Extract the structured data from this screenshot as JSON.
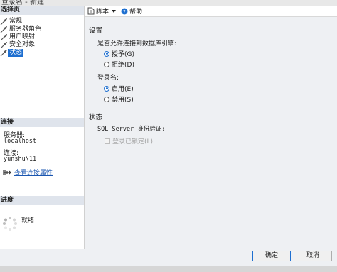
{
  "window": {
    "title": "登录名 - 新建"
  },
  "left_panel": {
    "select_page_header": "选择页",
    "nav_items": [
      {
        "label": "常规"
      },
      {
        "label": "服务器角色"
      },
      {
        "label": "用户映射"
      },
      {
        "label": "安全对象"
      },
      {
        "label": "状态",
        "selected": true
      }
    ],
    "connection_header": "连接",
    "server_label": "服务器:",
    "server_value": "localhost",
    "connection_label": "连接:",
    "connection_value": "yunshu\\11",
    "view_properties_link": "查看连接属性",
    "progress_header": "进度",
    "progress_status": "就绪"
  },
  "toolbar": {
    "script_label": "脚本",
    "help_label": "帮助"
  },
  "main": {
    "settings_heading": "设置",
    "db_engine_question": "是否允许连接到数据库引擎:",
    "grant_label": "授予(G)",
    "deny_label": "拒绝(D)",
    "login_label": "登录名:",
    "enabled_label": "启用(E)",
    "disabled_label": "禁用(S)",
    "status_heading": "状态",
    "sql_auth_label": "SQL Server 身份验证:",
    "locked_label": "登录已锁定(L)",
    "grant_selected": true,
    "enabled_selected": true
  },
  "footer": {
    "ok_label": "确定",
    "cancel_label": "取消"
  },
  "colors": {
    "accent": "#1e6fd0",
    "header_bg": "#dfe4ec",
    "link": "#1a56b0"
  }
}
